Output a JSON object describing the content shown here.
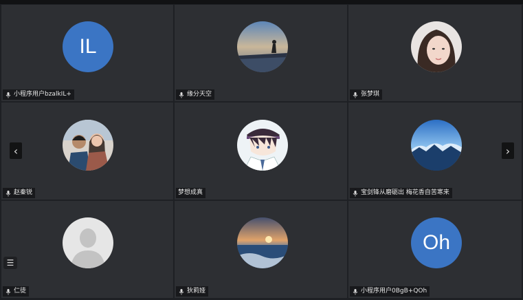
{
  "participants": [
    {
      "name": "小程序用户bzalkIL+",
      "avatar_type": "initials",
      "initials": "IL",
      "mic": true
    },
    {
      "name": "缘分天空",
      "avatar_type": "photo-sunset-pier",
      "mic": true
    },
    {
      "name": "张梦琪",
      "avatar_type": "photo-woman",
      "mic": true
    },
    {
      "name": "赵秦锐",
      "avatar_type": "photo-couple",
      "mic": true
    },
    {
      "name": "梦想成真",
      "avatar_type": "photo-anime",
      "mic": false
    },
    {
      "name": "宝剑锋从磨砺出 梅花香自苦寒来",
      "avatar_type": "photo-mountains",
      "mic": true
    },
    {
      "name": "仁徒",
      "avatar_type": "default-silhouette",
      "mic": true
    },
    {
      "name": "狄莉娅",
      "avatar_type": "photo-ocean-sunset",
      "mic": true
    },
    {
      "name": "小程序用户0BgB+QOh",
      "avatar_type": "initials",
      "initials": "Oh",
      "mic": true
    }
  ],
  "nav": {
    "prev_glyph": "‹",
    "next_glyph": "›"
  },
  "menu": {
    "glyph": "☰"
  },
  "colors": {
    "background": "#1e2024",
    "tile": "#2d2f33",
    "initials_avatar": "#3b75c4"
  }
}
